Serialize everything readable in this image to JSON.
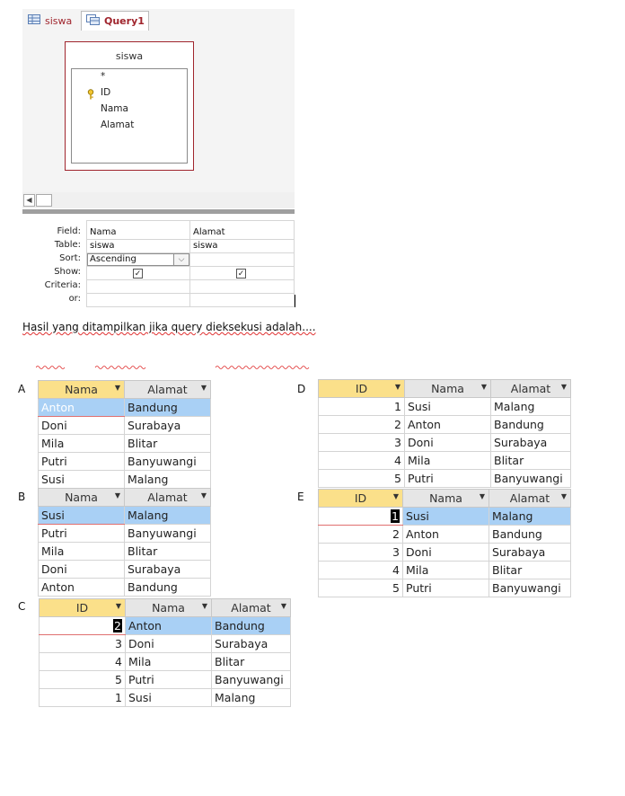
{
  "designer": {
    "tabs": [
      {
        "label": "siswa"
      },
      {
        "label": "Query1"
      }
    ],
    "table_box": {
      "title": "siswa",
      "fields": [
        "*",
        "ID",
        "Nama",
        "Alamat"
      ]
    },
    "grid": {
      "row_labels": [
        "Field:",
        "Table:",
        "Sort:",
        "Show:",
        "Criteria:",
        "or:"
      ],
      "columns": [
        {
          "field": "Nama",
          "table": "siswa",
          "sort": "Ascending",
          "show": true
        },
        {
          "field": "Alamat",
          "table": "siswa",
          "sort": "",
          "show": true
        }
      ]
    }
  },
  "question": "Hasil yang ditampilkan jika query dieksekusi adalah....",
  "options": {
    "A": {
      "label": "A",
      "headers": [
        "Nama",
        "Alamat"
      ],
      "rows": [
        [
          "Anton",
          "Bandung"
        ],
        [
          "Doni",
          "Surabaya"
        ],
        [
          "Mila",
          "Blitar"
        ],
        [
          "Putri",
          "Banyuwangi"
        ],
        [
          "Susi",
          "Malang"
        ]
      ]
    },
    "B": {
      "label": "B",
      "headers": [
        "Nama",
        "Alamat"
      ],
      "rows": [
        [
          "Susi",
          "Malang"
        ],
        [
          "Putri",
          "Banyuwangi"
        ],
        [
          "Mila",
          "Blitar"
        ],
        [
          "Doni",
          "Surabaya"
        ],
        [
          "Anton",
          "Bandung"
        ]
      ]
    },
    "C": {
      "label": "C",
      "headers": [
        "ID",
        "Nama",
        "Alamat"
      ],
      "rows": [
        [
          "2",
          "Anton",
          "Bandung"
        ],
        [
          "3",
          "Doni",
          "Surabaya"
        ],
        [
          "4",
          "Mila",
          "Blitar"
        ],
        [
          "5",
          "Putri",
          "Banyuwangi"
        ],
        [
          "1",
          "Susi",
          "Malang"
        ]
      ]
    },
    "D": {
      "label": "D",
      "headers": [
        "ID",
        "Nama",
        "Alamat"
      ],
      "rows": [
        [
          "1",
          "Susi",
          "Malang"
        ],
        [
          "2",
          "Anton",
          "Bandung"
        ],
        [
          "3",
          "Doni",
          "Surabaya"
        ],
        [
          "4",
          "Mila",
          "Blitar"
        ],
        [
          "5",
          "Putri",
          "Banyuwangi"
        ]
      ]
    },
    "E": {
      "label": "E",
      "headers": [
        "ID",
        "Nama",
        "Alamat"
      ],
      "rows": [
        [
          "1",
          "Susi",
          "Malang"
        ],
        [
          "2",
          "Anton",
          "Bandung"
        ],
        [
          "3",
          "Doni",
          "Surabaya"
        ],
        [
          "4",
          "Mila",
          "Blitar"
        ],
        [
          "5",
          "Putri",
          "Banyuwangi"
        ]
      ]
    }
  },
  "colors": {
    "accent": "#a0252d",
    "selected_row": "#a9d0f5",
    "sorted_header": "#fbe08a"
  },
  "icons": {
    "tab_table": "table-icon",
    "tab_query": "query-icon",
    "primary_key": "key-icon",
    "dropdown": "chevron-down-icon",
    "checkbox": "checkbox-checked-icon"
  }
}
